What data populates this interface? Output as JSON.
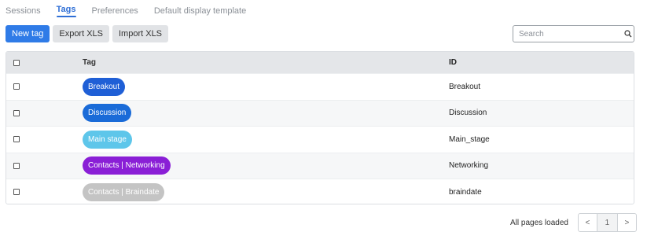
{
  "tabs": [
    {
      "label": "Sessions",
      "active": false
    },
    {
      "label": "Tags",
      "active": true
    },
    {
      "label": "Preferences",
      "active": false
    },
    {
      "label": "Default display template",
      "active": false
    }
  ],
  "toolbar": {
    "new_tag_label": "New tag",
    "export_label": "Export XLS",
    "import_label": "Import XLS"
  },
  "search": {
    "placeholder": "Search",
    "icon": "magnifier-icon"
  },
  "table": {
    "headers": {
      "tag": "Tag",
      "id": "ID"
    },
    "rows": [
      {
        "tag": "Breakout",
        "id": "Breakout",
        "color": "#1f5fd6"
      },
      {
        "tag": "Discussion",
        "id": "Discussion",
        "color": "#1a6bd8"
      },
      {
        "tag": "Main stage",
        "id": "Main_stage",
        "color": "#5ec6ea"
      },
      {
        "tag": "Contacts | Networking",
        "id": "Networking",
        "color": "#8a1fd6"
      },
      {
        "tag": "Contacts | Braindate",
        "id": "braindate",
        "color": "#c4c4c4"
      }
    ]
  },
  "pagination": {
    "status": "All pages loaded",
    "prev": "<",
    "page": "1",
    "next": ">"
  }
}
